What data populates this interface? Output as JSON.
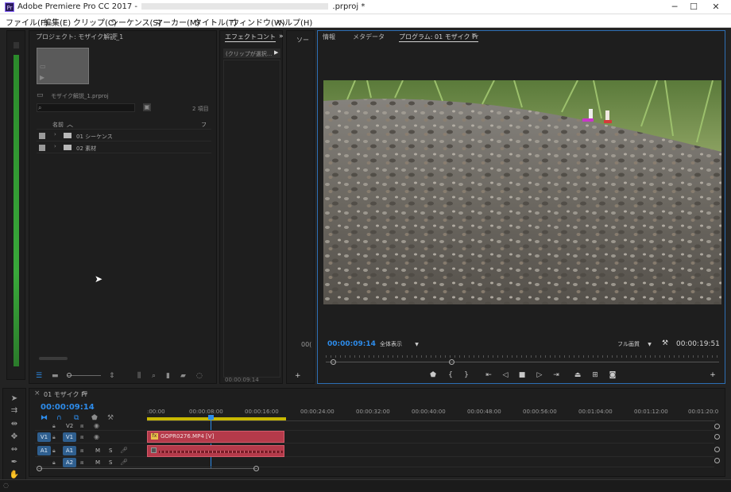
{
  "window": {
    "title_prefix": "Adobe Premiere Pro CC 2017 -",
    "title_suffix": ".prproj *",
    "app_icon": "Pr",
    "min": "─",
    "max": "☐",
    "close": "✕"
  },
  "menu": [
    "ファイル(F)",
    "編集(E)",
    "クリップ(C)",
    "シーケンス(S)",
    "マーカー(M)",
    "タイトル(T)",
    "ウィンドウ(W)",
    "ヘルプ(H)"
  ],
  "project": {
    "tab": "プロジェクト: モザイク解説_1",
    "file": "モザイク解説_1.prproj",
    "items_count": "2 項目",
    "col_name": "名前",
    "col_f": "フ",
    "items": [
      "01 シーケンス",
      "02 素材"
    ],
    "search_placeholder": ""
  },
  "effect_controls": {
    "tab": "エフェクトコント",
    "no_clip": "(クリップが選択...",
    "timecode": "00:00:09:14"
  },
  "source": {
    "tab": "ソー",
    "partial": "00("
  },
  "program": {
    "tabs": [
      "情報",
      "メタデータ"
    ],
    "active_tab": "プログラム: 01 モザイク Pr",
    "timecode": "00:00:09:14",
    "fit": "全体表示",
    "quality": "フル画質",
    "duration": "00:00:19:51"
  },
  "timeline": {
    "tab": "01 モザイク Pr",
    "timecode": "00:00:09:14",
    "ruler": [
      ":00:00",
      "00:00:08:00",
      "00:00:16:00",
      "00:00:24:00",
      "00:00:32:00",
      "00:00:40:00",
      "00:00:48:00",
      "00:00:56:00",
      "00:01:04:00",
      "00:01:12:00",
      "00:01:20:0"
    ],
    "tracks": {
      "v2": "V2",
      "v1_src": "V1",
      "v1": "V1",
      "a1_src": "A1",
      "a1": "A1",
      "a2": "A2",
      "m": "M",
      "s": "S"
    },
    "clip_name": "GOPR0276.MP4 [V]",
    "clip_fx": "fx"
  },
  "colors": {
    "accent": "#2d8ceb",
    "video_clip": "#b53a4a",
    "audio_clip": "#b53a4a",
    "track_btn": "#2f5f8f",
    "meter_green": "#39a83a"
  }
}
